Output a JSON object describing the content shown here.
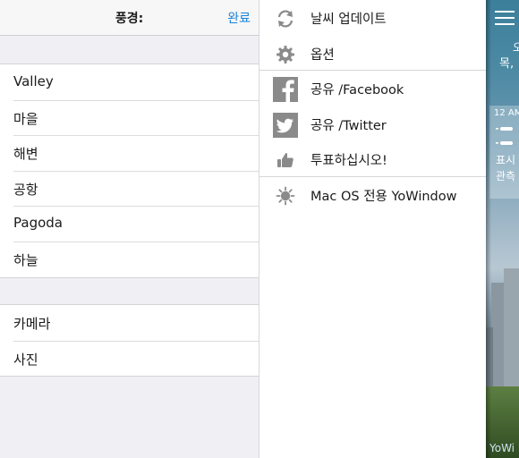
{
  "left_panel": {
    "title": "풍경:",
    "done_label": "완료",
    "scenes": [
      "Valley",
      "마을",
      "해변",
      "공항",
      "Pagoda",
      "하늘"
    ],
    "photo_options": [
      "카메라",
      "사진"
    ]
  },
  "menu": {
    "items": [
      {
        "label": "날씨 업데이트",
        "icon": "refresh-icon"
      },
      {
        "label": "옵션",
        "icon": "gear-icon"
      },
      {
        "label": "공유 /Facebook",
        "icon": "facebook-icon"
      },
      {
        "label": "공유 /Twitter",
        "icon": "twitter-icon"
      },
      {
        "label": "투표하십시오!",
        "icon": "thumbs-up-icon"
      },
      {
        "label": "Mac OS 전용 YoWindow",
        "icon": "sun-icon"
      }
    ]
  },
  "weather": {
    "line1": "오",
    "line2": "목,",
    "time": "12 AM",
    "card_line1": "표시",
    "card_line2": "관측",
    "brand": "YoWi"
  },
  "colors": {
    "accent": "#1a82d7",
    "grouped_background": "#efeff4",
    "icon_gray": "#888888"
  }
}
